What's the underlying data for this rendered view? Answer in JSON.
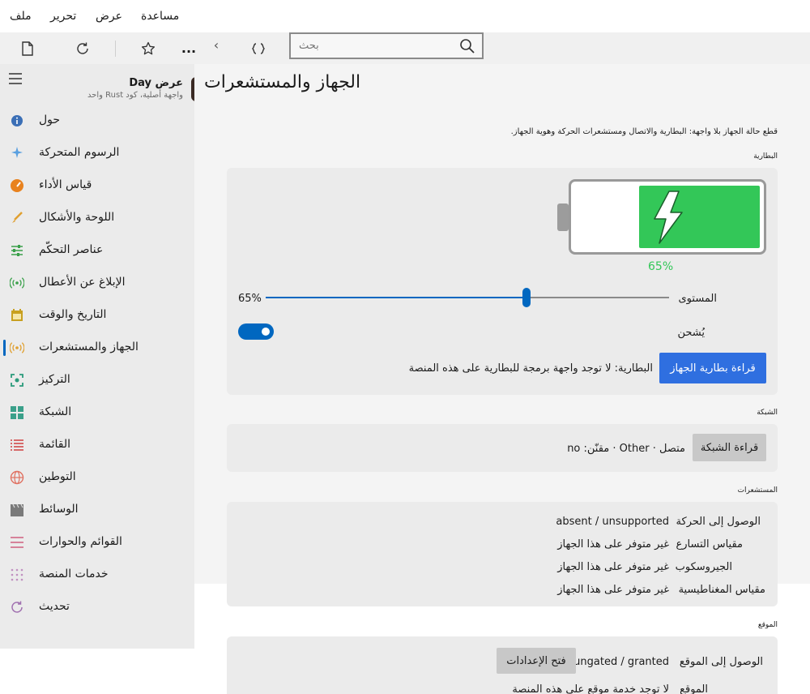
{
  "menubar": {
    "file": "ملف",
    "edit": "تحرير",
    "view": "عرض",
    "help": "مساعدة"
  },
  "toolbar": {
    "search_placeholder": "بحث",
    "more_label": "..."
  },
  "app": {
    "title": "عرض Day",
    "subtitle": "واجهة أصلية، كود Rust واحد"
  },
  "sidebar": {
    "items": [
      {
        "label": "حول",
        "icon": "info-icon",
        "color": "#3b6fb6"
      },
      {
        "label": "الرسوم المتحركة",
        "icon": "sparkle-icon",
        "color": "#5aa0e0"
      },
      {
        "label": "قياس الأداء",
        "icon": "gauge-icon",
        "color": "#e8821e"
      },
      {
        "label": "اللوحة والأشكال",
        "icon": "brush-icon",
        "color": "#e0a030"
      },
      {
        "label": "عناصر التحكّم",
        "icon": "sliders-icon",
        "color": "#3aa04a"
      },
      {
        "label": "الإبلاغ عن الأعطال",
        "icon": "broadcast-icon",
        "color": "#3aa04a"
      },
      {
        "label": "التاريخ والوقت",
        "icon": "calendar-icon",
        "color": "#c8a020"
      },
      {
        "label": "الجهاز والمستشعرات",
        "icon": "broadcast-icon",
        "color": "#e0a030"
      },
      {
        "label": "التركيز",
        "icon": "focus-icon",
        "color": "#2a9a7a"
      },
      {
        "label": "الشبكة",
        "icon": "grid-icon",
        "color": "#3aa08a"
      },
      {
        "label": "القائمة",
        "icon": "list-icon",
        "color": "#d04040"
      },
      {
        "label": "التوطين",
        "icon": "globe-icon",
        "color": "#e07060"
      },
      {
        "label": "الوسائط",
        "icon": "clapper-icon",
        "color": "#7a7a7a"
      },
      {
        "label": "القوائم والحوارات",
        "icon": "menu-lines-icon",
        "color": "#d06080"
      },
      {
        "label": "خدمات المنصة",
        "icon": "dots-grid-icon",
        "color": "#c090c0"
      },
      {
        "label": "تحديث",
        "icon": "refresh-icon",
        "color": "#a070b0"
      }
    ],
    "selected_index": 7,
    "accent": "#0067c0"
  },
  "page": {
    "title": "الجهاز والمستشعرات",
    "description": "قطع حالة الجهاز بلا واجهة: البطارية والاتصال ومستشعرات الحركة وهوية الجهاز."
  },
  "battery": {
    "section": "البطارية",
    "percent_text": "65%",
    "level": 0.65,
    "level_label": "المستوى",
    "level_value": "65%",
    "charging_label": "يُشحن",
    "charging": true,
    "read_button": "قراءة بطارية الجهاز",
    "status": "البطارية: لا توجد واجهة برمجة للبطارية على هذه المنصة",
    "fill_color": "#33c758"
  },
  "network": {
    "section": "الشبكة",
    "read_button": "قراءة الشبكة",
    "status": "متصل · Other · مقنّن: no"
  },
  "sensors": {
    "section": "المستشعرات",
    "rows": [
      {
        "label": "الوصول إلى الحركة",
        "value": "absent / unsupported"
      },
      {
        "label": "مقياس التسارع",
        "value": "غير متوفر على هذا الجهاز"
      },
      {
        "label": "الجيروسكوب",
        "value": "غير متوفر على هذا الجهاز"
      },
      {
        "label": "مقياس المغناطيسية",
        "value": "غير متوفر على هذا الجهاز"
      }
    ]
  },
  "location": {
    "section": "الموقع",
    "access_label": "الوصول إلى الموقع",
    "access_value": "ungated / granted",
    "settings_button": "فتح الإعدادات",
    "location_label": "الموقع",
    "location_value": "لا توجد خدمة موقع على هذه المنصة"
  }
}
